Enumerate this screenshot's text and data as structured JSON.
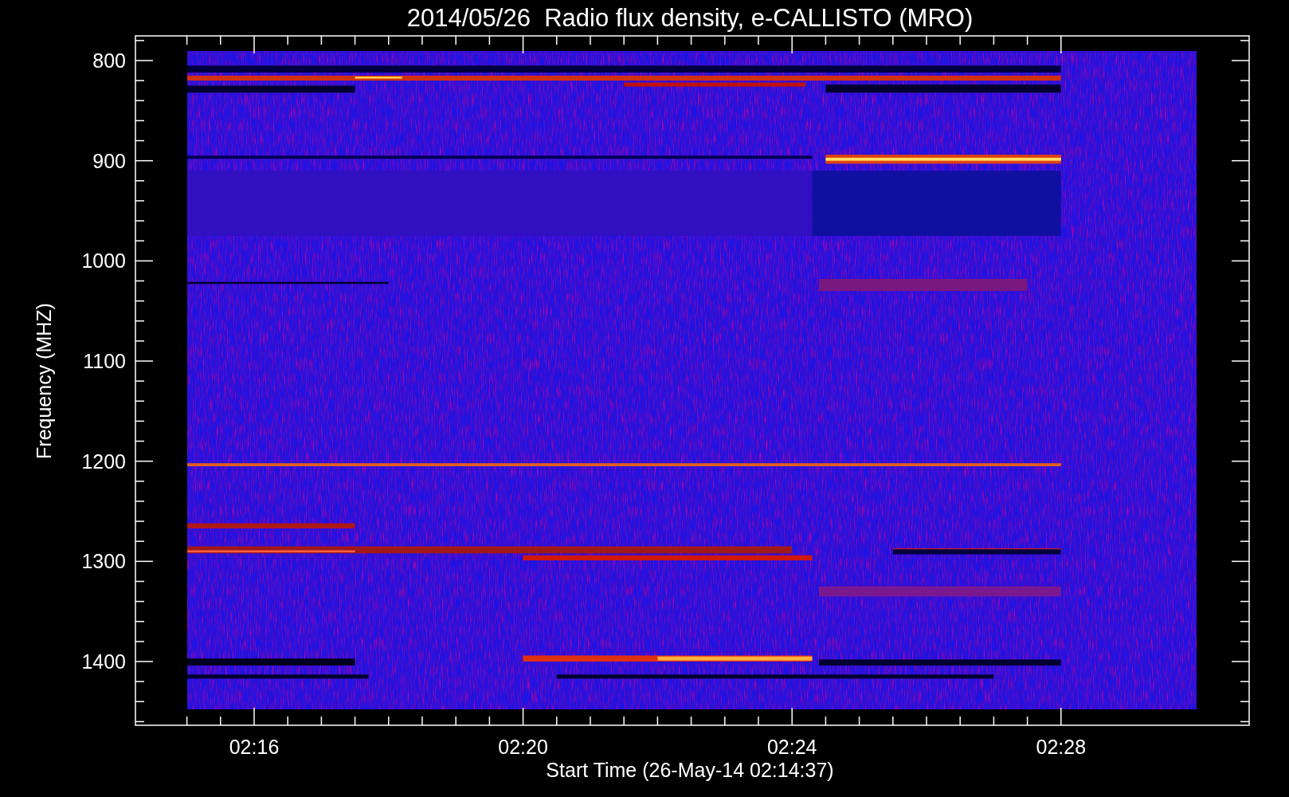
{
  "title": "2014/05/26  Radio flux density, e-CALLISTO (MRO)",
  "plot": {
    "ylabel": "Frequency (MHZ)",
    "xlabel": "Start Time (26-May-14 02:14:37)",
    "yticks": [
      "800",
      "900",
      "1000",
      "1100",
      "1200",
      "1300",
      "1400"
    ],
    "xticks": [
      "02:16",
      "02:20",
      "02:24",
      "02:28"
    ]
  }
}
